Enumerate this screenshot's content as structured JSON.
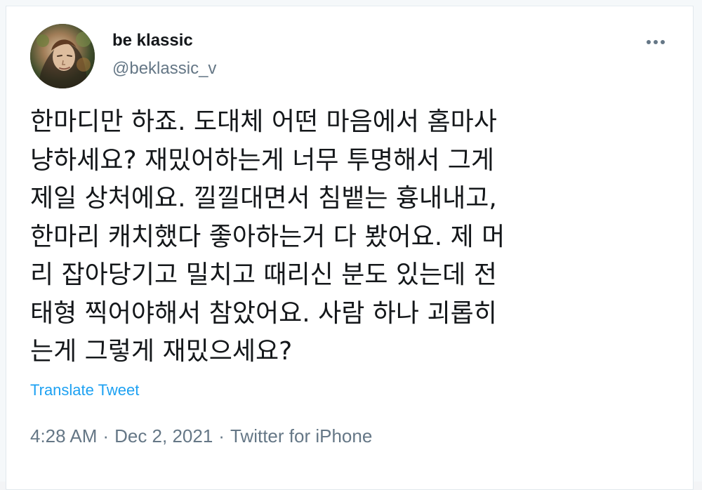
{
  "tweet": {
    "author": {
      "name": "be klassic",
      "handle": "@beklassic_v"
    },
    "text": "한마디만 하죠. 도대체 어떤 마음에서 홈마사\n냥하세요? 재밌어하는게 너무 투명해서 그게\n제일 상처에요. 낄낄대면서 침뱉는 흉내내고,\n한마리 캐치했다 좋아하는거 다 봤어요. 제 머\n리 잡아당기고 밀치고 때리신 분도 있는데 전\n태형 찍어야해서 참았어요. 사람 하나 괴롭히\n는게 그렇게 재밌으세요?",
    "translate_label": "Translate Tweet",
    "time": "4:28 AM",
    "separator": "·",
    "date": "Dec 2, 2021",
    "source": "Twitter for iPhone"
  },
  "icons": {
    "more": "more-icon",
    "avatar": "avatar"
  },
  "colors": {
    "text": "#14171a",
    "secondary": "#657786",
    "link": "#1da1f2",
    "border": "#e1e8ed"
  }
}
